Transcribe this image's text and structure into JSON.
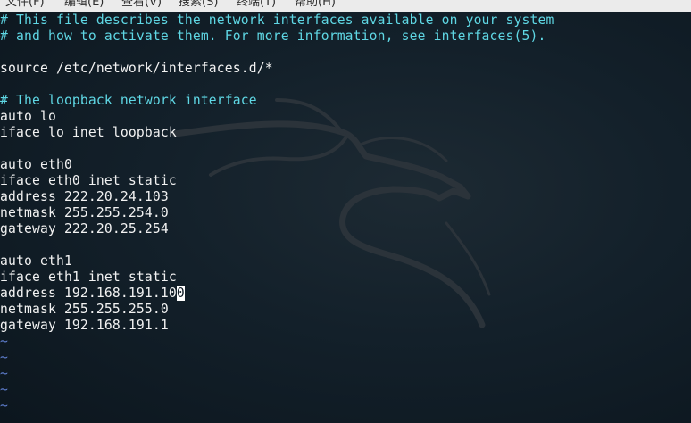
{
  "menubar": {
    "items": [
      "文件(F)",
      "编辑(E)",
      "查看(V)",
      "搜索(S)",
      "终端(T)",
      "帮助(H)"
    ]
  },
  "editor": {
    "lines": [
      {
        "text": "# This file describes the network interfaces available on your system",
        "kind": "comment"
      },
      {
        "text": "# and how to activate them. For more information, see interfaces(5).",
        "kind": "comment"
      },
      {
        "text": "",
        "kind": "text"
      },
      {
        "text": "source /etc/network/interfaces.d/*",
        "kind": "text"
      },
      {
        "text": "",
        "kind": "text"
      },
      {
        "text": "# The loopback network interface",
        "kind": "comment"
      },
      {
        "text": "auto lo",
        "kind": "text"
      },
      {
        "text": "iface lo inet loopback",
        "kind": "text"
      },
      {
        "text": "",
        "kind": "text"
      },
      {
        "text": "auto eth0",
        "kind": "text"
      },
      {
        "text": "iface eth0 inet static",
        "kind": "text"
      },
      {
        "text": "address 222.20.24.103",
        "kind": "text"
      },
      {
        "text": "netmask 255.255.254.0",
        "kind": "text"
      },
      {
        "text": "gateway 222.20.25.254",
        "kind": "text"
      },
      {
        "text": "",
        "kind": "text"
      },
      {
        "text": "auto eth1",
        "kind": "text"
      },
      {
        "text": "iface eth1 inet static",
        "kind": "text"
      },
      {
        "text": "address 192.168.191.100",
        "kind": "text",
        "cursor_col": 22
      },
      {
        "text": "netmask 255.255.255.0",
        "kind": "text"
      },
      {
        "text": "gateway 192.168.191.1",
        "kind": "text"
      },
      {
        "text": "~",
        "kind": "tilde"
      },
      {
        "text": "~",
        "kind": "tilde"
      },
      {
        "text": "~",
        "kind": "tilde"
      },
      {
        "text": "~",
        "kind": "tilde"
      },
      {
        "text": "~",
        "kind": "tilde"
      }
    ]
  },
  "colors": {
    "background": "#0f1b24",
    "comment": "#5fd7e4",
    "text": "#f2f2f2",
    "tilde": "#5f7fd0",
    "cursor": "#ffffff"
  }
}
